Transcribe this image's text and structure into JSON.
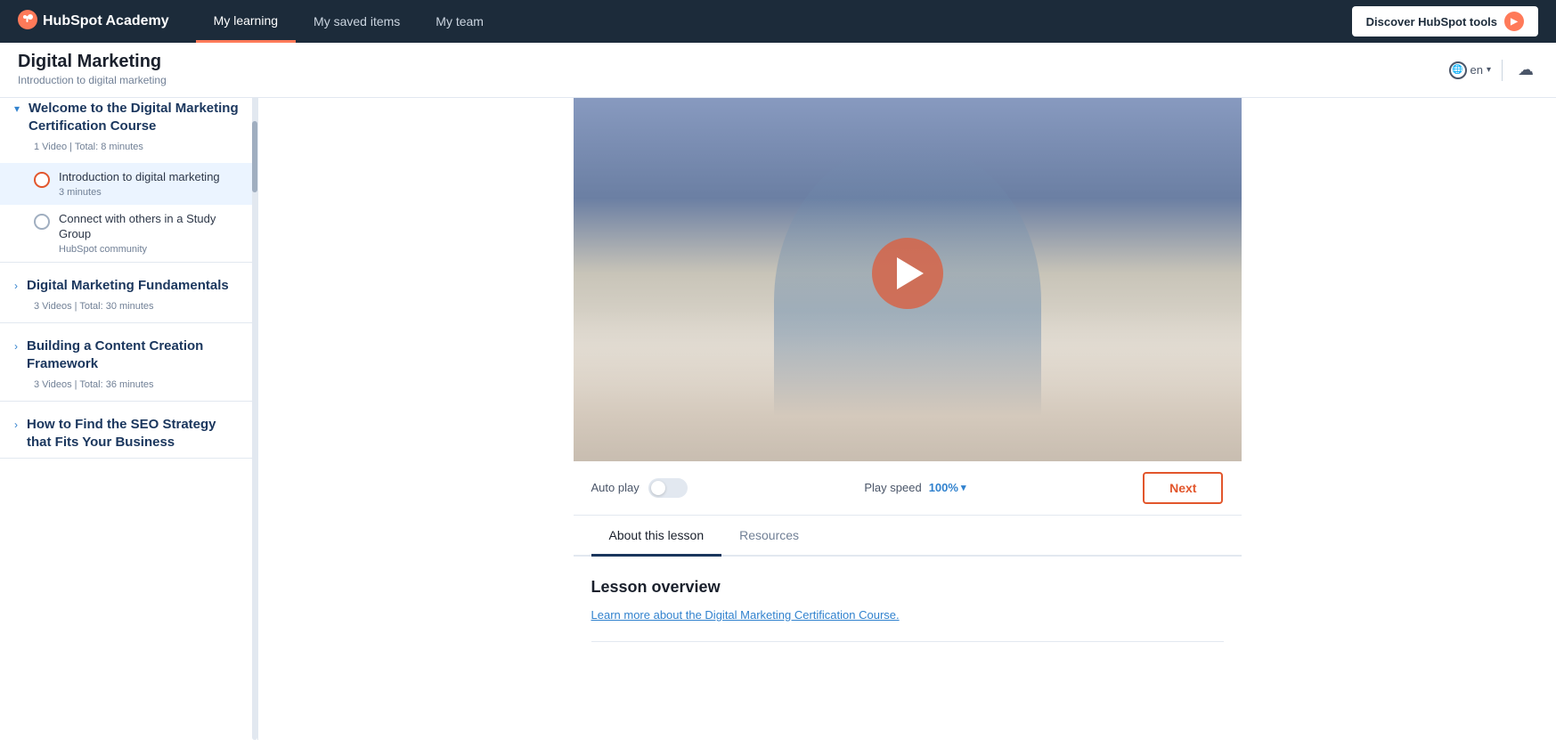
{
  "header": {
    "logo_text": "HubSpot Academy",
    "nav_items": [
      {
        "label": "My learning",
        "active": true
      },
      {
        "label": "My saved items",
        "active": false
      },
      {
        "label": "My team",
        "active": false
      }
    ],
    "discover_btn": "Discover HubSpot tools",
    "lang": "en"
  },
  "page_title": {
    "title": "Digital Marketing",
    "subtitle": "Introduction to digital marketing"
  },
  "sidebar": {
    "sections": [
      {
        "id": "section-1",
        "expanded": true,
        "title": "Welcome to the Digital Marketing Certification Course",
        "meta": "1 Video | Total: 8 minutes",
        "lessons": [
          {
            "title": "Introduction to digital marketing",
            "duration": "3 minutes",
            "active": true,
            "dot_type": "orange"
          },
          {
            "title": "Connect with others in a Study Group",
            "duration": "HubSpot community",
            "active": false,
            "dot_type": "gray"
          }
        ]
      },
      {
        "id": "section-2",
        "expanded": false,
        "title": "Digital Marketing Fundamentals",
        "meta": "3 Videos | Total: 30 minutes",
        "lessons": []
      },
      {
        "id": "section-3",
        "expanded": false,
        "title": "Building a Content Creation Framework",
        "meta": "3 Videos | Total: 36 minutes",
        "lessons": []
      },
      {
        "id": "section-4",
        "expanded": false,
        "title": "How to Find the SEO Strategy that Fits Your Business",
        "meta": "",
        "lessons": []
      }
    ]
  },
  "video": {
    "autoplay_label": "Auto play",
    "playspeed_label": "Play speed",
    "playspeed_value": "100%",
    "next_btn": "Next"
  },
  "tabs": [
    {
      "label": "About this lesson",
      "active": true
    },
    {
      "label": "Resources",
      "active": false
    }
  ],
  "lesson": {
    "overview_title": "Lesson overview",
    "overview_link": "Learn more about the Digital Marketing Certification Course."
  }
}
